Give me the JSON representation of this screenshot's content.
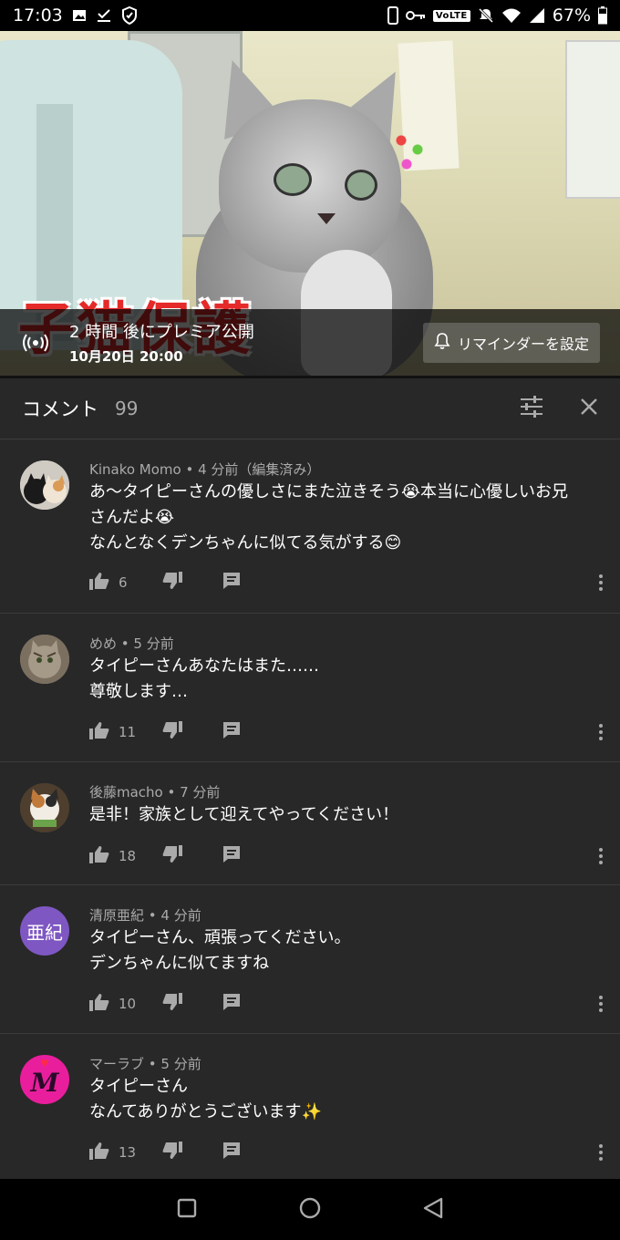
{
  "status_bar": {
    "time": "17:03",
    "left_icons": [
      "image-icon",
      "download-done-icon",
      "shield-icon"
    ],
    "right_icons": [
      "phone-icon",
      "key-icon",
      "volte-badge",
      "mute-icon",
      "wifi-icon",
      "signal-icon",
      "battery-icon"
    ],
    "volte_label": "VoLTE",
    "battery": "67%"
  },
  "video": {
    "overlay_title": "子猫保護",
    "premiere": {
      "line1": "2 時間 後にプレミア公開",
      "line2": "10月20日 20:00",
      "icon": "live-broadcast-icon"
    },
    "reminder_button": "リマインダーを設定"
  },
  "comments_header": {
    "title": "コメント",
    "count": "99",
    "filter_icon": "sort-icon",
    "close_icon": "close-icon"
  },
  "comments": [
    {
      "author": "Kinako Momo",
      "time": "4 分前（編集済み）",
      "meta": "Kinako Momo • 4 分前（編集済み）",
      "lines": [
        "あ〜タイピーさんの優しさにまた泣きそう😭本当に心優しいお兄",
        "さんだよ😭",
        "なんとなくデンちゃんに似てる気がする😊"
      ],
      "likes": "6",
      "avatar": "two-cats-avatar"
    },
    {
      "author": "めめ",
      "time": "5 分前",
      "meta": "めめ • 5 分前",
      "lines": [
        "タイピーさんあなたはまた……",
        "尊敬します…"
      ],
      "likes": "11",
      "avatar": "tabby-cat-avatar"
    },
    {
      "author": "後藤macho",
      "time": "7 分前",
      "meta": "後藤macho • 7 分前",
      "lines": [
        "是非！家族として迎えてやってください！"
      ],
      "likes": "18",
      "avatar": "calico-cat-avatar"
    },
    {
      "author": "清原亜紀",
      "time": "4 分前",
      "meta": "清原亜紀 • 4 分前",
      "lines": [
        "タイピーさん、頑張ってください。",
        "デンちゃんに似てますね"
      ],
      "likes": "10",
      "avatar_text": "亜紀",
      "avatar_color": "#7e57c2"
    },
    {
      "author": "マーラブ",
      "time": "5 分前",
      "meta": "マーラブ • 5 分前",
      "lines": [
        "タイピーさん",
        "なんてありがとうございます✨"
      ],
      "likes": "13",
      "avatar_text": "M",
      "avatar_color": "#e91e9c"
    }
  ],
  "nav_bar": {
    "icons": [
      "recents-square-icon",
      "home-circle-icon",
      "back-triangle-icon"
    ]
  },
  "colors": {
    "background": "#282828",
    "text_secondary": "#aaaaaa",
    "divider": "#3c3c3c"
  }
}
